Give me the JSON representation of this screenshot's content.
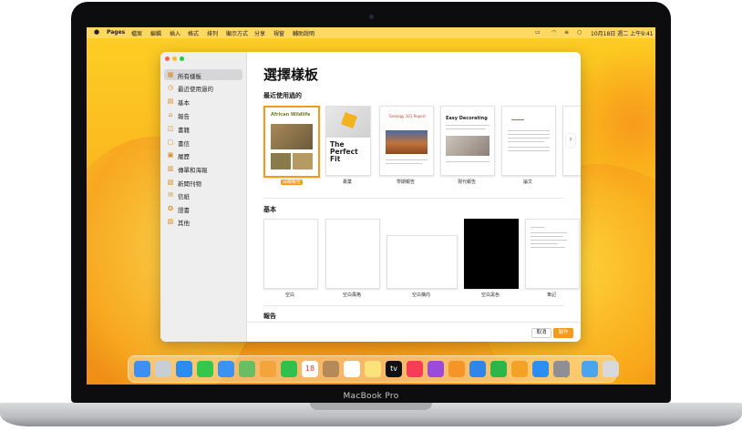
{
  "device": {
    "label": "MacBook Pro"
  },
  "menubar": {
    "apple": "",
    "items": [
      "Pages",
      "檔案",
      "編輯",
      "插入",
      "格式",
      "排列",
      "顯示方式",
      "分享",
      "視窗",
      "輔助說明"
    ],
    "clock": "10月18日 週二 上午9:41"
  },
  "sidebar": {
    "items": [
      {
        "label": "所有樣板",
        "icon": "grid-icon"
      },
      {
        "label": "最近使用過的",
        "icon": "clock-icon"
      },
      {
        "label": "基本",
        "icon": "document-icon"
      },
      {
        "label": "報告",
        "icon": "graduation-icon"
      },
      {
        "label": "書籍",
        "icon": "book-icon"
      },
      {
        "label": "書信",
        "icon": "letter-icon"
      },
      {
        "label": "履歷",
        "icon": "resume-icon"
      },
      {
        "label": "傳單和海報",
        "icon": "flyer-icon"
      },
      {
        "label": "新聞刊物",
        "icon": "newspaper-icon"
      },
      {
        "label": "信紙",
        "icon": "stationery-icon"
      },
      {
        "label": "證書",
        "icon": "certificate-icon"
      },
      {
        "label": "其他",
        "icon": "misc-icon"
      }
    ]
  },
  "main": {
    "title": "選擇樣板",
    "recent": {
      "heading": "最近使用過的",
      "templates": [
        {
          "caption": "兩欄報告",
          "title": "African Wildlife"
        },
        {
          "caption": "專業",
          "title": "The Perfect Fit"
        },
        {
          "caption": "學期報告",
          "title": "Geology 101 Report"
        },
        {
          "caption": "現代報告",
          "title": "Easy Decorating"
        },
        {
          "caption": "論文",
          "title": ""
        }
      ]
    },
    "basic": {
      "heading": "基本",
      "templates": [
        {
          "caption": "空白"
        },
        {
          "caption": "空白風格"
        },
        {
          "caption": "空白橫向"
        },
        {
          "caption": "空白黑色"
        },
        {
          "caption": "筆記"
        }
      ]
    },
    "reports": {
      "heading": "報告"
    },
    "footer": {
      "cancel": "取消",
      "create": "製作"
    }
  },
  "colors": {
    "accent": "#f39a1a",
    "sidebar": "#eeeeef"
  },
  "dock": {
    "apps": [
      {
        "name": "finder-icon",
        "color": "#3d8ff2"
      },
      {
        "name": "launchpad-icon",
        "color": "#c9cdd6"
      },
      {
        "name": "safari-icon",
        "color": "#2a8cf0"
      },
      {
        "name": "messages-icon",
        "color": "#36c64c"
      },
      {
        "name": "mail-icon",
        "color": "#3a92f2"
      },
      {
        "name": "maps-icon",
        "color": "#69bd62"
      },
      {
        "name": "photos-icon",
        "color": "#f3a43b"
      },
      {
        "name": "facetime-icon",
        "color": "#2fc14b"
      },
      {
        "name": "calendar-icon",
        "color": "#ffffff",
        "text": "18"
      },
      {
        "name": "contacts-icon",
        "color": "#b58a5a"
      },
      {
        "name": "reminders-icon",
        "color": "#ffffff"
      },
      {
        "name": "notes-icon",
        "color": "#fbe27a"
      },
      {
        "name": "tv-icon",
        "color": "#111111",
        "text": "tv"
      },
      {
        "name": "music-icon",
        "color": "#f63d55"
      },
      {
        "name": "podcasts-icon",
        "color": "#9b4ad9"
      },
      {
        "name": "books-icon",
        "color": "#f59427"
      },
      {
        "name": "keynote-icon",
        "color": "#2f86e8"
      },
      {
        "name": "numbers-icon",
        "color": "#2cb548"
      },
      {
        "name": "pages-icon",
        "color": "#f4a227"
      },
      {
        "name": "appstore-icon",
        "color": "#2b8ef3"
      },
      {
        "name": "settings-icon",
        "color": "#8e8e93"
      },
      {
        "name": "downloads-folder-icon",
        "color": "#4aa4ee"
      },
      {
        "name": "trash-icon",
        "color": "#d8d9dc"
      }
    ]
  }
}
